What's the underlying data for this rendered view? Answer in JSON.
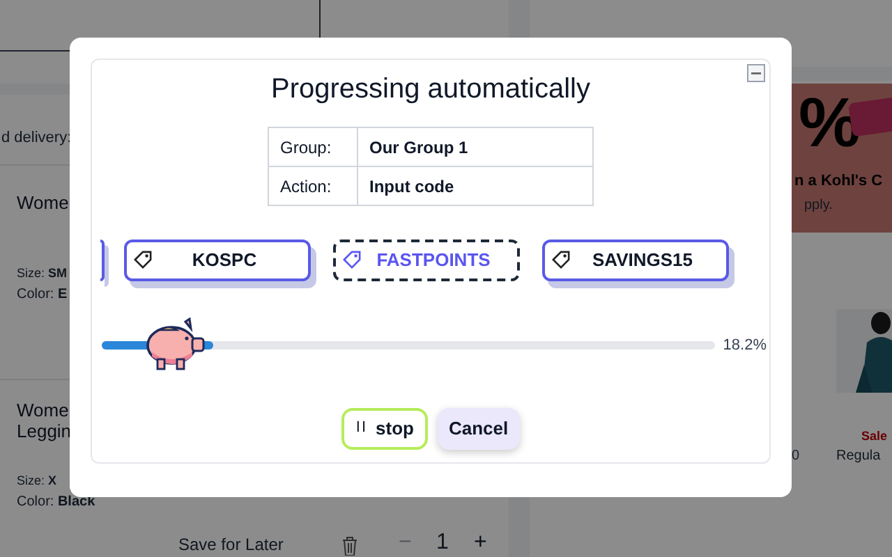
{
  "background": {
    "delivery_note": "d delivery:",
    "items": [
      {
        "name_lines": [
          "Wome"
        ],
        "size_label": "Size:",
        "size": "SM",
        "color_label": "Color:",
        "color_value": "E"
      },
      {
        "name_lines": [
          "Wome",
          "Leggin"
        ],
        "size_label": "Size:",
        "size": "X",
        "color_label": "Color:",
        "color_value": "Black"
      }
    ],
    "save_for_later": "Save for Later",
    "quantity": "1",
    "minus": "−",
    "plus": "+",
    "promo": {
      "big": "%",
      "line_1": "n a Kohl's C",
      "line_2": "pply."
    },
    "product": {
      "price_fragment": "0",
      "sale": "Sale",
      "regular": "Regula"
    }
  },
  "dialog": {
    "title": "Progressing automatically",
    "info": [
      {
        "label": "Group:",
        "value": "Our Group 1"
      },
      {
        "label": "Action:",
        "value": "Input code"
      }
    ],
    "codes": [
      {
        "code": "KOSPC",
        "selected": false
      },
      {
        "code": "FASTPOINTS",
        "selected": true
      },
      {
        "code": "SAVINGS15",
        "selected": false
      }
    ],
    "progress": {
      "level": 0.182,
      "reading": "18.2%"
    },
    "stop_button": {
      "icon": "II",
      "label": "stop"
    },
    "cancel_button": "Cancel"
  }
}
